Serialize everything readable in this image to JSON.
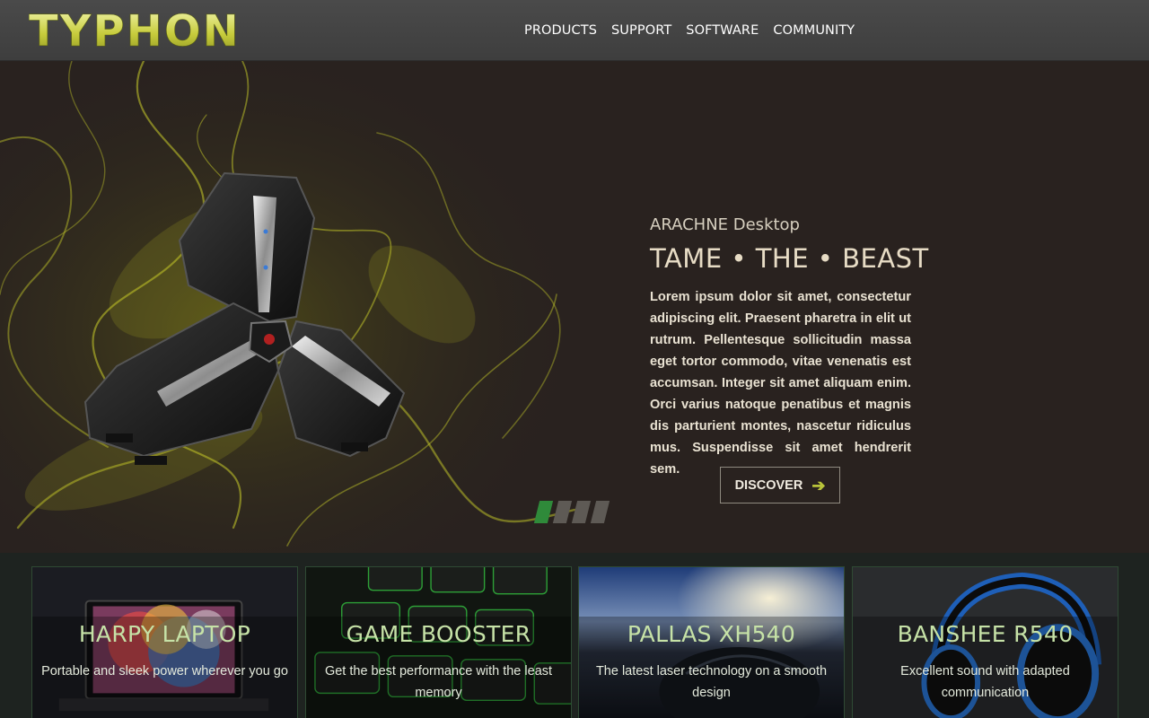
{
  "brand": {
    "name": "TYPHON",
    "accent": "#c8cc3a"
  },
  "nav": {
    "items": [
      {
        "label": "PRODUCTS"
      },
      {
        "label": "SUPPORT"
      },
      {
        "label": "SOFTWARE"
      },
      {
        "label": "COMMUNITY"
      }
    ]
  },
  "hero": {
    "subtitle": "ARACHNE Desktop",
    "title": "TAME • THE • BEAST",
    "body": "Lorem ipsum dolor sit amet, consectetur adipiscing elit. Praesent pharetra in elit ut rutrum. Pellentesque sollicitudin massa eget tortor commodo, vitae venenatis est accumsan. Integer sit amet aliquam enim. Orci varius natoque penatibus et magnis dis parturient montes, nascetur ridiculus mus. Suspendisse sit amet hendrerit sem.",
    "cta_label": "DISCOVER",
    "cta_icon": "arrow-right-icon",
    "slides": {
      "count": 4,
      "active_index": 0
    }
  },
  "products": [
    {
      "title": "HARPY LAPTOP",
      "description": "Portable and sleek power wherever you go",
      "image": "laptop"
    },
    {
      "title": "GAME BOOSTER",
      "description": "Get the best performance with the least memory",
      "image": "keyboard"
    },
    {
      "title": "PALLAS XH540",
      "description": "The latest laser technology on a smooth design",
      "image": "mouse"
    },
    {
      "title": "BANSHEE R540",
      "description": "Excellent sound with adapted communication",
      "image": "headset"
    }
  ],
  "colors": {
    "navbar": "#444444",
    "hero_bg": "#29221f",
    "card_title": "#c6e2a7",
    "slide_active": "#2f8a3a"
  }
}
